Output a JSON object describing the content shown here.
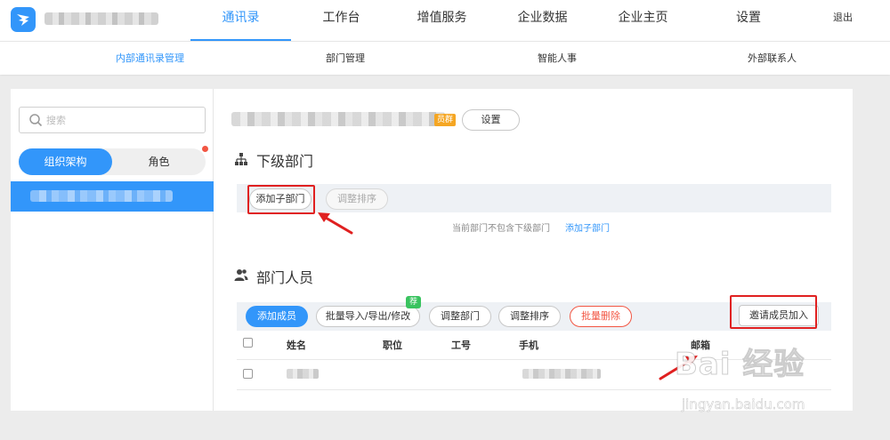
{
  "top_nav": {
    "tabs": [
      {
        "label": "通讯录",
        "active": true
      },
      {
        "label": "工作台",
        "active": false
      },
      {
        "label": "增值服务",
        "active": false
      },
      {
        "label": "企业数据",
        "active": false
      },
      {
        "label": "企业主页",
        "active": false
      },
      {
        "label": "设置",
        "active": false
      }
    ],
    "logout": "退出"
  },
  "sub_nav": {
    "tabs": [
      {
        "label": "内部通讯录管理",
        "active": true
      },
      {
        "label": "部门管理",
        "active": false
      },
      {
        "label": "智能人事",
        "active": false
      },
      {
        "label": "外部联系人",
        "active": false
      }
    ]
  },
  "sidebar": {
    "search_placeholder": "搜索",
    "switch": {
      "org": "组织架构",
      "role": "角色"
    }
  },
  "dept_header": {
    "badge": "员群",
    "settings_btn": "设置"
  },
  "sub_departments": {
    "title": "下级部门",
    "add_btn": "添加子部门",
    "sort_btn": "调整排序",
    "empty_hint": "当前部门不包含下级部门",
    "empty_link": "添加子部门"
  },
  "members": {
    "title": "部门人员",
    "buttons": {
      "add": "添加成员",
      "bulk": "批量导入/导出/修改",
      "new_tag": "荐",
      "move": "调整部门",
      "sort": "调整排序",
      "delete": "批量删除",
      "invite": "邀请成员加入"
    },
    "columns": [
      "姓名",
      "职位",
      "工号",
      "手机",
      "邮箱"
    ]
  },
  "watermark": {
    "text": "Bai 经验",
    "url": "jingyan.baidu.com"
  },
  "colors": {
    "accent": "#3296fa",
    "danger": "#f25643",
    "annotation": "#e02020",
    "new_tag": "#39c35f",
    "badge": "#f5a623"
  }
}
